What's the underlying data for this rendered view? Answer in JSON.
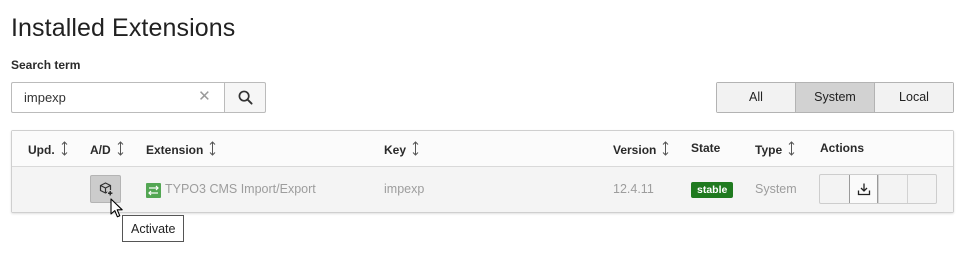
{
  "page": {
    "title": "Installed Extensions"
  },
  "search": {
    "label": "Search term",
    "value": "impexp",
    "clear_icon": "close-icon",
    "button_icon": "search-icon"
  },
  "filters": {
    "options": [
      "All",
      "System",
      "Local"
    ],
    "selected": "System"
  },
  "table": {
    "columns": {
      "upd": "Upd.",
      "ad": "A/D",
      "extension": "Extension",
      "key": "Key",
      "version": "Version",
      "state": "State",
      "type": "Type",
      "actions": "Actions"
    },
    "rows": [
      {
        "extension": "TYPO3 CMS Import/Export",
        "key": "impexp",
        "version": "12.4.11",
        "state": "stable",
        "type": "System",
        "ad_icon": "activate-extension-icon",
        "extension_icon": "import-export-icon",
        "action_icons": [
          "blank",
          "download-icon",
          "blank",
          "blank"
        ]
      }
    ]
  },
  "tooltip": {
    "text": "Activate"
  },
  "colors": {
    "state_stable": "#1f7a1f",
    "selected_filter": "#d2d2d2",
    "extension_icon": "#53a653"
  }
}
